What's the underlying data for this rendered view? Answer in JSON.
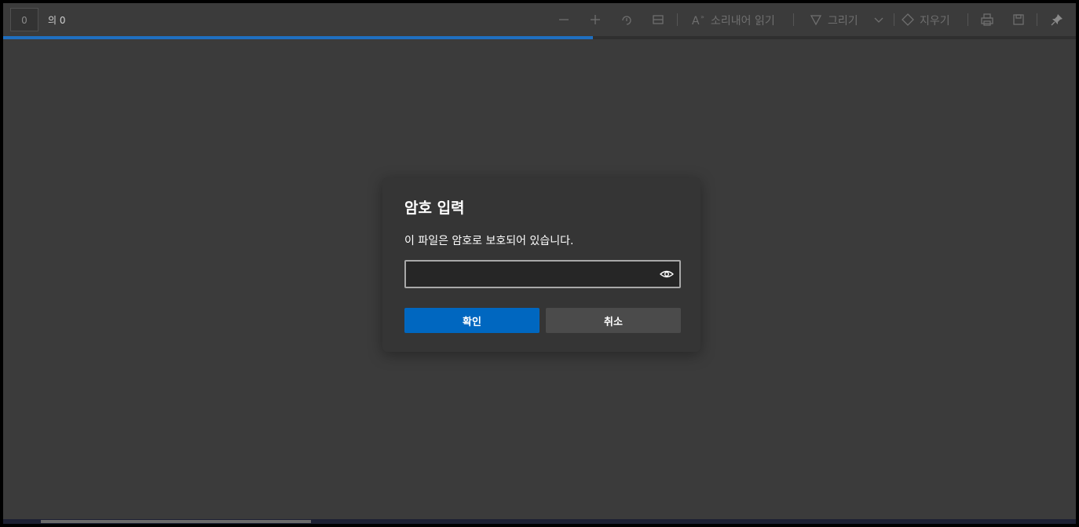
{
  "toolbar": {
    "page_current": "0",
    "page_total": "의 0",
    "read_aloud_label": "소리내어 읽기",
    "draw_label": "그리기",
    "erase_label": "지우기",
    "icons": [
      "minus-icon",
      "plus-icon",
      "rotate-icon",
      "fit-page-icon",
      "read-aloud-icon",
      "draw-icon",
      "chevron-down-icon",
      "eraser-icon",
      "print-icon",
      "save-icon",
      "pin-icon"
    ]
  },
  "load_progress": 0.55,
  "dialog": {
    "title": "암호 입력",
    "message": "이 파일은 암호로 보호되어 있습니다.",
    "password_value": "",
    "ok_label": "확인",
    "cancel_label": "취소"
  },
  "colors": {
    "accent": "#0067c0",
    "background": "#3b3b3b",
    "dialog": "#353535"
  }
}
